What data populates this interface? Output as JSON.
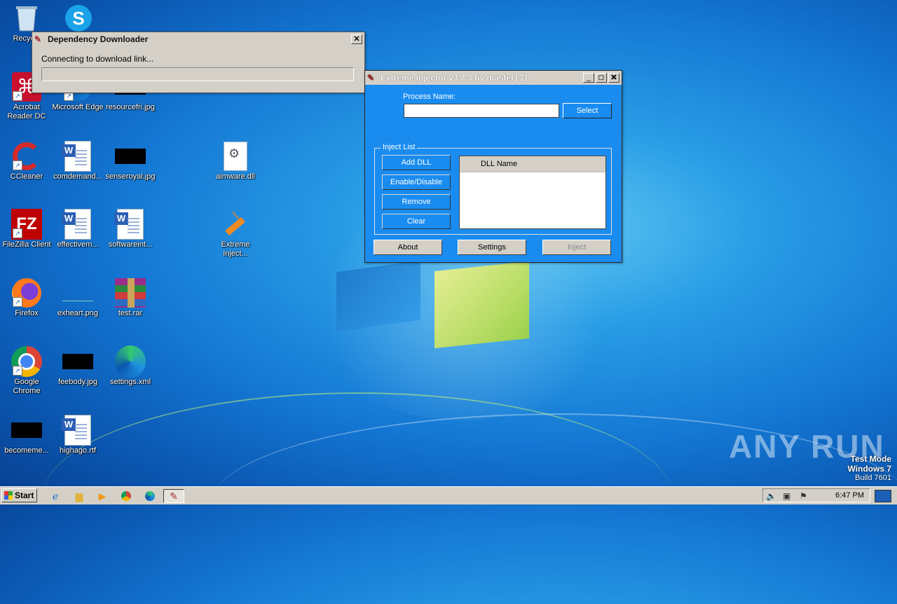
{
  "desktop": {
    "icons": [
      {
        "label": "Recycle",
        "glyph": "recycle-bin-icon"
      },
      {
        "label": "S",
        "glyph": "skype-icon"
      },
      {
        "label": "Acrobat Reader DC",
        "line1": "Acrobat",
        "line2": "Reader DC",
        "glyph": "acrobat-icon"
      },
      {
        "label": "Microsoft Edge",
        "glyph": "edge-icon"
      },
      {
        "label": "resourcefri.jpg",
        "glyph": "image-thumbnail-icon"
      },
      {
        "label": "CCleaner",
        "glyph": "ccleaner-icon"
      },
      {
        "label": "comdemand...",
        "glyph": "word-document-icon"
      },
      {
        "label": "senseroyal.jpg",
        "glyph": "image-thumbnail-icon"
      },
      {
        "label": "aimware.dll",
        "glyph": "dll-settings-icon"
      },
      {
        "label": "FileZilla Client",
        "glyph": "filezilla-icon"
      },
      {
        "label": "effectivem...",
        "glyph": "word-document-icon"
      },
      {
        "label": "softwareint...",
        "glyph": "word-document-icon"
      },
      {
        "label": "Extreme Inject...",
        "line1": "Extreme",
        "line2": "Inject...",
        "glyph": "syringe-icon"
      },
      {
        "label": "Firefox",
        "glyph": "firefox-icon"
      },
      {
        "label": "exheart.png",
        "glyph": "image-thumbnail-icon"
      },
      {
        "label": "test.rar",
        "glyph": "winrar-icon"
      },
      {
        "label": "Google Chrome",
        "line1": "Google",
        "line2": "Chrome",
        "glyph": "chrome-icon"
      },
      {
        "label": "feebody.jpg",
        "glyph": "image-thumbnail-icon"
      },
      {
        "label": "settings.xml",
        "glyph": "edge-icon"
      },
      {
        "label": "becomeme...",
        "glyph": "image-thumbnail-icon"
      },
      {
        "label": "highago.rtf",
        "glyph": "word-document-icon"
      }
    ]
  },
  "downloader": {
    "title": "Dependency Downloader",
    "message": "Connecting to download link...",
    "progress": 0,
    "close": "✕"
  },
  "injector": {
    "title": "Extreme Injector v3.7.3 by master131",
    "process_label": "Process Name:",
    "process_value": "",
    "select_label": "Select",
    "group_label": "Inject List",
    "buttons": [
      "Add DLL",
      "Enable/Disable",
      "Remove",
      "Clear"
    ],
    "list_header": "DLL Name",
    "about": "About",
    "settings": "Settings",
    "inject": "Inject",
    "minimize": "_",
    "maximize": "□",
    "close": "✕"
  },
  "taskbar": {
    "start": "Start",
    "clock": "6:47 PM",
    "items": [
      "internet-explorer-icon",
      "file-explorer-icon",
      "media-player-icon",
      "chrome-icon",
      "edge-icon",
      "extreme-injector-icon"
    ]
  },
  "watermark": {
    "line1": "Test Mode",
    "line2": "Windows 7",
    "line3": "Build 7601",
    "brand": "ANY RUN"
  },
  "colors": {
    "injector_bg": "#1a8cf0",
    "dialog_bg": "#d4d0c8"
  }
}
